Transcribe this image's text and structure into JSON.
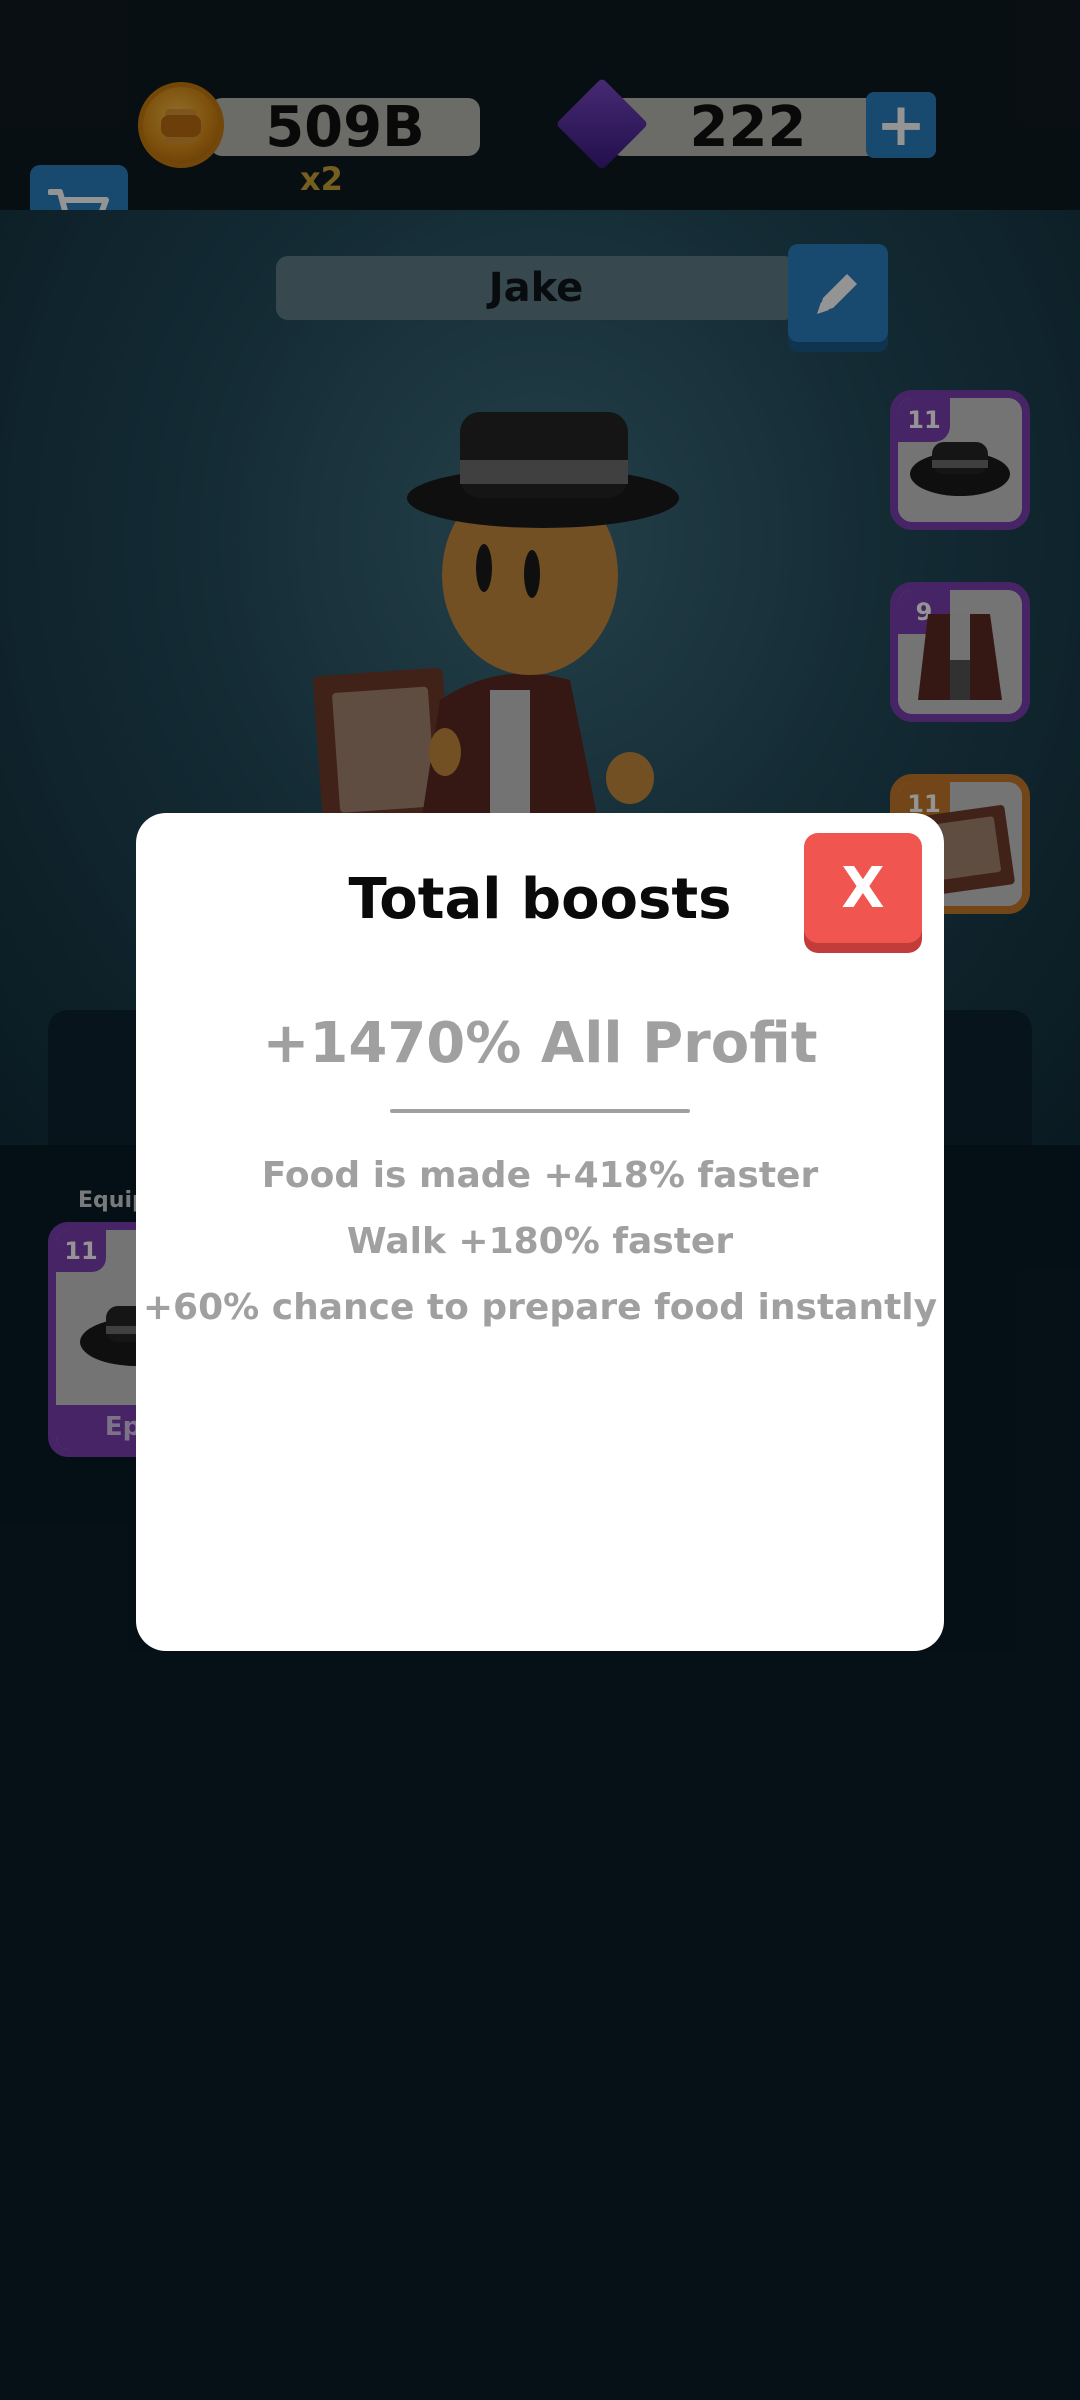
{
  "currency": {
    "coins": "509B",
    "multiplier": "x2",
    "gems": "222",
    "add_label": "+"
  },
  "player": {
    "name": "Jake"
  },
  "equipment_slots": [
    {
      "level": "11",
      "item": "hat-icon",
      "rarity_color": "#7b3fb0"
    },
    {
      "level": "9",
      "item": "coat-icon",
      "rarity_color": "#7b3fb0"
    },
    {
      "level": "11",
      "item": "book-icon",
      "rarity_color": "#c7792c"
    }
  ],
  "equipped_card": {
    "header_visible": "Equip",
    "level": "11",
    "rarity_visible": "Ep"
  },
  "modal": {
    "title": "Total boosts",
    "close_label": "X",
    "profit": "+1470% All Profit",
    "boosts": [
      "Food is made +418% faster",
      "Walk +180% faster",
      "+60% chance to prepare food instantly"
    ]
  }
}
